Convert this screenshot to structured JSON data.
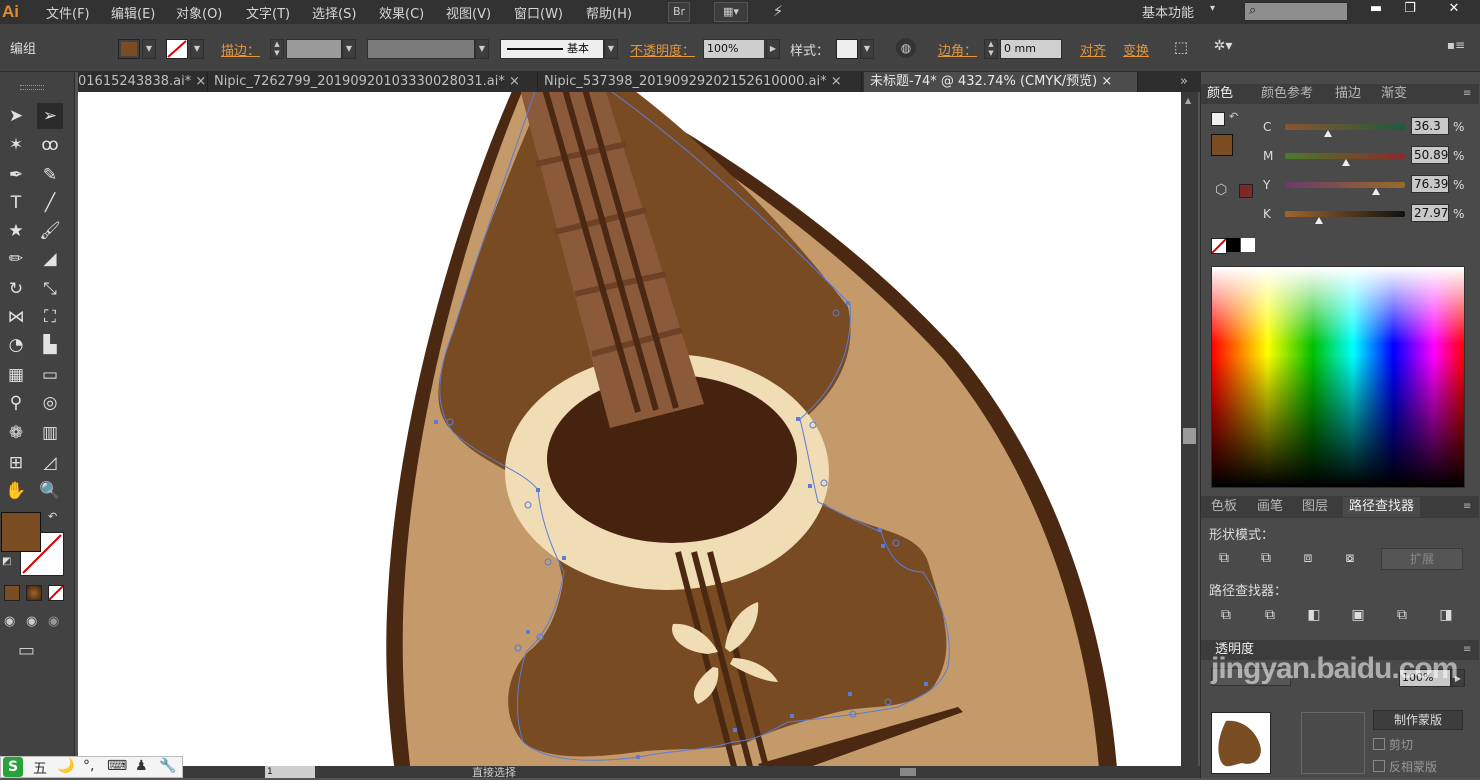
{
  "menubar": {
    "logo": "Ai",
    "items": [
      "文件(F)",
      "编辑(E)",
      "对象(O)",
      "文字(T)",
      "选择(S)",
      "效果(C)",
      "视图(V)",
      "窗口(W)",
      "帮助(H)"
    ],
    "bridge_label": "Br",
    "workspace": "基本功能",
    "workspace_arrow": "▾"
  },
  "control": {
    "selection_type": "编组",
    "stroke_label": "描边：",
    "stroke_style": "基本",
    "opacity_label": "不透明度：",
    "opacity_value": "100%",
    "style_label": "样式：",
    "corner_label": "边角：",
    "corner_value": "0 mm",
    "align_label": "对齐",
    "transform_label": "变换",
    "fill_color": "#7a4d22"
  },
  "tabs": [
    {
      "label": "01615243838.ai* ×"
    },
    {
      "label": "Nipic_7262799_20190920103330028031.ai* ×"
    },
    {
      "label": "Nipic_537398_20190929202152610000.ai* ×"
    },
    {
      "label": "未标题-74* @ 432.74% (CMYK/预览) ×"
    }
  ],
  "tabs_overflow": "»",
  "panels": {
    "color": {
      "tabs": [
        "颜色",
        "颜色参考",
        "描边",
        "渐变"
      ],
      "channels": [
        {
          "name": "C",
          "value": "36.3",
          "level": 0.36
        },
        {
          "name": "M",
          "value": "50.89",
          "level": 0.51
        },
        {
          "name": "Y",
          "value": "76.39",
          "level": 0.76
        },
        {
          "name": "K",
          "value": "27.97",
          "level": 0.28
        }
      ],
      "percent": "%",
      "current_color": "#7a4d22"
    },
    "pathfinder": {
      "tabs": [
        "色板",
        "画笔",
        "图层",
        "路径查找器"
      ],
      "shape_modes_label": "形状模式：",
      "expand_label": "扩展",
      "pathfinders_label": "路径查找器："
    },
    "transparency": {
      "title": "透明度",
      "opacity": "100%",
      "make_mask": "制作蒙版",
      "clip": "剪切",
      "invert_mask": "反相蒙版"
    }
  },
  "status": {
    "tool_name": "直接选择",
    "page": "1"
  },
  "watermark": "jingyan.baidu.com",
  "ime": {
    "mode": "五",
    "items": [
      "🌙",
      "°,",
      "⌨",
      "♟",
      "🔧"
    ]
  }
}
